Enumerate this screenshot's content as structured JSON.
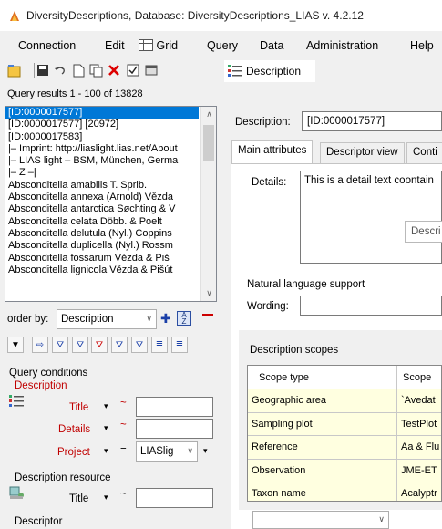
{
  "window": {
    "title": "DiversityDescriptions,  Database: DiversityDescriptions_LIAS   v. 4.2.12"
  },
  "menu": [
    {
      "label": "Connection"
    },
    {
      "label": "Edit"
    },
    {
      "label": "Grid"
    },
    {
      "label": "Query"
    },
    {
      "label": "Data"
    },
    {
      "label": "Administration"
    },
    {
      "label": "Help"
    }
  ],
  "description_tab": {
    "label": "Description"
  },
  "query_results": {
    "label": "Query results   1 - 100 of 13828",
    "items": [
      "[ID:0000017577]",
      "[ID:0000017577] [20972]",
      "[ID:0000017583]",
      "|– Imprint: http://liaslight.lias.net/About",
      "|– LIAS light – BSM, München, Germa",
      "|– Z –|",
      "Absconditella amabilis T. Sprib.",
      "Absconditella annexa (Arnold) Vězda",
      "Absconditella antarctica Søchting & V",
      "Absconditella celata Döbb. & Poelt",
      "Absconditella delutula (Nyl.) Coppins",
      "Absconditella duplicella (Nyl.) Rossm",
      "Absconditella fossarum Vězda & Piš",
      "Absconditella lignicola Vězda & Pišút"
    ]
  },
  "order_by": {
    "label": "order by:",
    "value": "Description"
  },
  "query_conditions": {
    "label": "Query conditions",
    "section": "Description",
    "title_label": "Title",
    "details_label": "Details",
    "project_label": "Project",
    "project_value": "LIASlig",
    "tilde": "~",
    "equals": "="
  },
  "description_resource": {
    "label": "Description resource",
    "title_label": "Title",
    "tilde": "~"
  },
  "descriptor": {
    "label": "Descriptor"
  },
  "detail": {
    "description_label": "Description:",
    "description_value": "[ID:0000017577]",
    "tabs": [
      "Main attributes",
      "Descriptor view",
      "Conti"
    ],
    "details_label": "Details:",
    "details_value": "This is a detail text coontain",
    "tooltip_stub": "Descri",
    "nls_label": "Natural language support",
    "wording_label": "Wording:",
    "scopes_label": "Description scopes",
    "scopes_columns": [
      "Scope type",
      "Scope"
    ],
    "scopes_rows": [
      [
        "Geographic area",
        "`Avedat"
      ],
      [
        "Sampling plot",
        "TestPlot"
      ],
      [
        "Reference",
        "Aa & Flu"
      ],
      [
        "Observation",
        "JME-ET"
      ],
      [
        "Taxon name",
        "Acalyptr"
      ]
    ]
  },
  "colors": {
    "selection": "#0078d7",
    "required": "#c00000",
    "grid_row": "#ffffe0"
  }
}
